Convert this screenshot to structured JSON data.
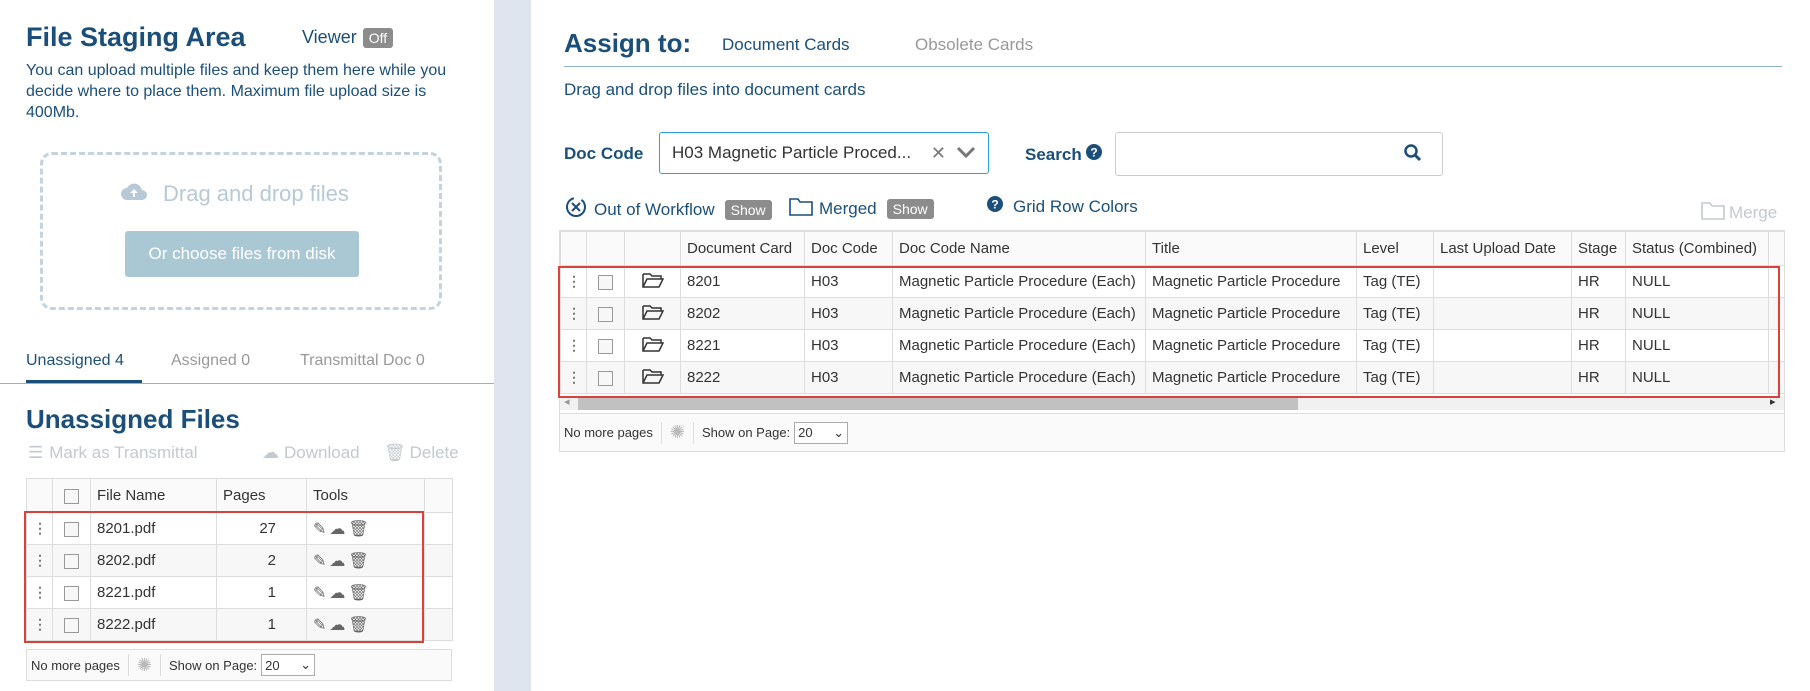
{
  "staging": {
    "title": "File Staging Area",
    "viewer_label": "Viewer",
    "viewer_state": "Off",
    "description": "You can upload multiple files and keep them here while you decide where to place them. Maximum file upload size is 400Mb.",
    "drop_text": "Drag and drop files",
    "choose_button": "Or choose files from disk",
    "tabs": [
      {
        "label": "Unassigned 4",
        "active": true
      },
      {
        "label": "Assigned 0",
        "active": false
      },
      {
        "label": "Transmittal Doc 0",
        "active": false
      }
    ],
    "unassigned_title": "Unassigned Files",
    "actions": {
      "mark_transmittal": "Mark as Transmittal",
      "download": "Download",
      "delete": "Delete"
    },
    "columns": [
      "File Name",
      "Pages",
      "Tools"
    ],
    "rows": [
      {
        "file": "8201.pdf",
        "pages": "27"
      },
      {
        "file": "8202.pdf",
        "pages": "2"
      },
      {
        "file": "8221.pdf",
        "pages": "1"
      },
      {
        "file": "8222.pdf",
        "pages": "1"
      }
    ],
    "pager": {
      "no_more": "No more pages",
      "show_on_page": "Show on Page:",
      "page_size": "20"
    }
  },
  "assign": {
    "title": "Assign to:",
    "tabs": [
      {
        "label": "Document Cards",
        "active": true
      },
      {
        "label": "Obsolete Cards",
        "active": false
      }
    ],
    "subtitle": "Drag and drop files into document cards",
    "doc_code_label": "Doc Code",
    "doc_code_value": "H03 Magnetic Particle Proced...",
    "search_label": "Search",
    "search_value": "",
    "out_of_workflow_label": "Out of Workflow",
    "out_of_workflow_state": "Show",
    "merged_label": "Merged",
    "merged_state": "Show",
    "grid_row_colors": "Grid Row Colors",
    "merge_label": "Merge",
    "columns": [
      "Document Card",
      "Doc Code",
      "Doc Code Name",
      "Title",
      "Level",
      "Last Upload Date",
      "Stage",
      "Status (Combined)"
    ],
    "rows": [
      {
        "card": "8201",
        "code": "H03",
        "code_name": "Magnetic Particle Procedure (Each)",
        "title": "Magnetic Particle Procedure",
        "level": "Tag (TE)",
        "upload": "",
        "stage": "HR",
        "status": "NULL"
      },
      {
        "card": "8202",
        "code": "H03",
        "code_name": "Magnetic Particle Procedure (Each)",
        "title": "Magnetic Particle Procedure",
        "level": "Tag (TE)",
        "upload": "",
        "stage": "HR",
        "status": "NULL"
      },
      {
        "card": "8221",
        "code": "H03",
        "code_name": "Magnetic Particle Procedure (Each)",
        "title": "Magnetic Particle Procedure",
        "level": "Tag (TE)",
        "upload": "",
        "stage": "HR",
        "status": "NULL"
      },
      {
        "card": "8222",
        "code": "H03",
        "code_name": "Magnetic Particle Procedure (Each)",
        "title": "Magnetic Particle Procedure",
        "level": "Tag (TE)",
        "upload": "",
        "stage": "HR",
        "status": "NULL"
      }
    ],
    "pager": {
      "no_more": "No more pages",
      "show_on_page": "Show on Page:",
      "page_size": "20"
    }
  },
  "icons": [
    "upload-cloud-icon",
    "list-icon",
    "cloud-download-icon",
    "trash-icon",
    "pencil-icon",
    "folder-open-icon",
    "help-icon",
    "search-icon",
    "clear-icon",
    "chevron-down-icon",
    "workflow-icon",
    "folder-icon",
    "spinner-icon"
  ],
  "colors": {
    "navy": "#1b4f79",
    "highlight": "#d9423a",
    "accent_border": "#2a9fd8",
    "badge": "#8c8c8c"
  }
}
